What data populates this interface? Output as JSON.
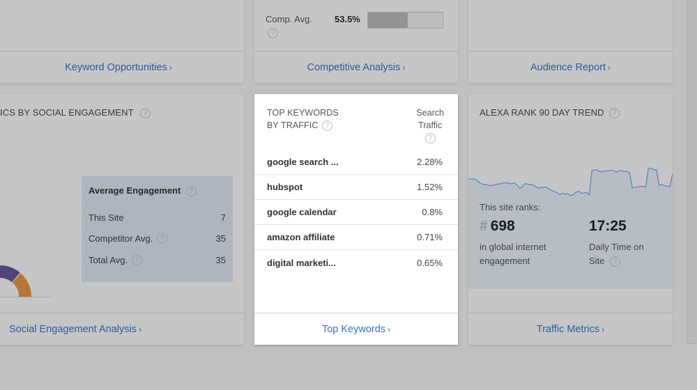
{
  "top_row": {
    "keyword_opportunities": {
      "link_label": "Keyword Opportunities"
    },
    "competitive_analysis": {
      "comp_avg_label": "Comp. Avg.",
      "comp_avg_value": "53.5%",
      "comp_avg_percent": 53.5,
      "link_label": "Competitive Analysis"
    },
    "audience": {
      "link_label": "Audience Report"
    }
  },
  "social": {
    "title": "ICS BY SOCIAL ENGAGEMENT",
    "donut_colors": {
      "purple": "#4f4578",
      "orange": "#b87636"
    },
    "average_engagement": {
      "title": "Average Engagement",
      "rows": [
        {
          "label": "This Site",
          "value": "7",
          "help": false
        },
        {
          "label": "Competitor Avg.",
          "value": "35",
          "help": true
        },
        {
          "label": "Total Avg.",
          "value": "35",
          "help": true
        }
      ]
    },
    "link_label": "Social Engagement Analysis"
  },
  "top_keywords": {
    "title_line1": "TOP KEYWORDS",
    "title_line2": "BY TRAFFIC",
    "col_header_line1": "Search",
    "col_header_line2": "Traffic",
    "rows": [
      {
        "keyword": "google search ...",
        "traffic": "2.28%"
      },
      {
        "keyword": "hubspot",
        "traffic": "1.52%"
      },
      {
        "keyword": "google calendar",
        "traffic": "0.8%"
      },
      {
        "keyword": "amazon affiliate",
        "traffic": "0.71%"
      },
      {
        "keyword": "digital marketi...",
        "traffic": "0.65%"
      }
    ],
    "link_label": "Top Keywords"
  },
  "alexa": {
    "title": "ALEXA RANK 90 DAY TREND",
    "ranks_label": "This site ranks:",
    "rank_hash": "#",
    "rank_value": "698",
    "rank_sub_line1": "in global internet",
    "rank_sub_line2": "engagement",
    "time_value": "17:25",
    "time_sub_line1": "Daily Time on",
    "time_sub_line2": "Site",
    "trend_values": [
      60,
      60,
      60,
      58,
      52,
      48,
      47,
      46,
      44,
      45,
      46,
      48,
      48,
      51,
      51,
      50,
      48,
      51,
      46,
      38,
      41,
      49,
      48,
      46,
      46,
      42,
      38,
      40,
      40,
      41,
      36,
      33,
      30,
      27,
      22,
      26,
      24,
      25,
      21,
      22,
      28,
      31,
      26,
      26,
      28,
      22,
      80,
      82,
      81,
      78,
      78,
      79,
      80,
      81,
      80,
      77,
      79,
      80,
      78,
      78,
      75,
      39,
      40,
      41,
      42,
      43,
      40,
      85,
      86,
      82,
      82,
      45,
      47,
      44,
      43,
      41,
      72
    ],
    "link_label": "Traffic Metrics",
    "line_color": "#5b86c4"
  },
  "icons": {
    "help": "?",
    "chevron": "›"
  }
}
